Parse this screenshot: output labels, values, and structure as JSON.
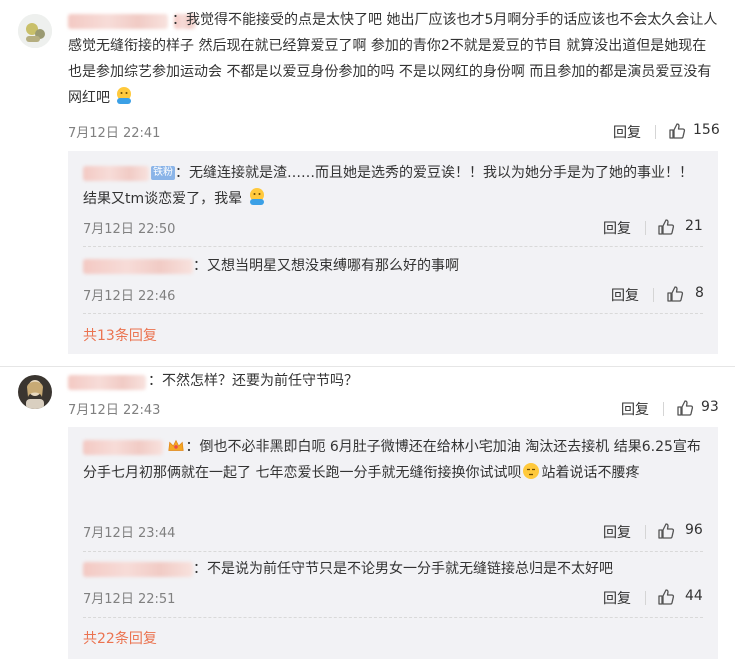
{
  "comments": [
    {
      "text": "我觉得不能接受的点是太快了吧 她出厂应该也才5月啊分手的话应该也不会太久会让人感觉无缝衔接的样子 然后现在就已经算爱豆了啊 参加的青你2不就是爱豆的节目 就算没出道但是她现在也是参加综艺参加运动会 不都是以爱豆身份参加的吗 不是以网红的身份啊 而且参加的都是演员爱豆没有网红吧",
      "time": "7月12日 22:41",
      "reply_label": "回复",
      "likes": "156",
      "replies": [
        {
          "text": "无缝连接就是渣……而且她是选秀的爱豆诶！！我以为她分手是为了她的事业！！结果又tm谈恋爱了，我晕",
          "time": "7月12日 22:50",
          "reply_label": "回复",
          "likes": "21",
          "badge": "铁粉"
        },
        {
          "text": "又想当明星又想没束缚哪有那么好的事啊",
          "time": "7月12日 22:46",
          "reply_label": "回复",
          "likes": "8"
        }
      ],
      "more_label": "共13条回复"
    },
    {
      "text": "不然怎样？还要为前任守节吗？",
      "time": "7月12日 22:43",
      "reply_label": "回复",
      "likes": "93",
      "replies": [
        {
          "text_a": "倒也不必非黑即白呃 6月肚子微博还在给林小宅加油 淘汰还去接机 结果6.25宣布分手七月初那俩就在一起了 七年恋爱长跑一分手就无缝衔接换你试试呗",
          "text_b": "站着说话不腰疼",
          "time": "7月12日 23:44",
          "reply_label": "回复",
          "likes": "96"
        },
        {
          "text": "不是说为前任守节只是不论男女一分手就无缝链接总归是不太好吧",
          "time": "7月12日 22:51",
          "reply_label": "回复",
          "likes": "44"
        }
      ],
      "more_label": "共22条回复"
    }
  ],
  "colors": {
    "link": "#eb7350",
    "reply_bg": "#f2f2f5",
    "meta": "#808080"
  }
}
